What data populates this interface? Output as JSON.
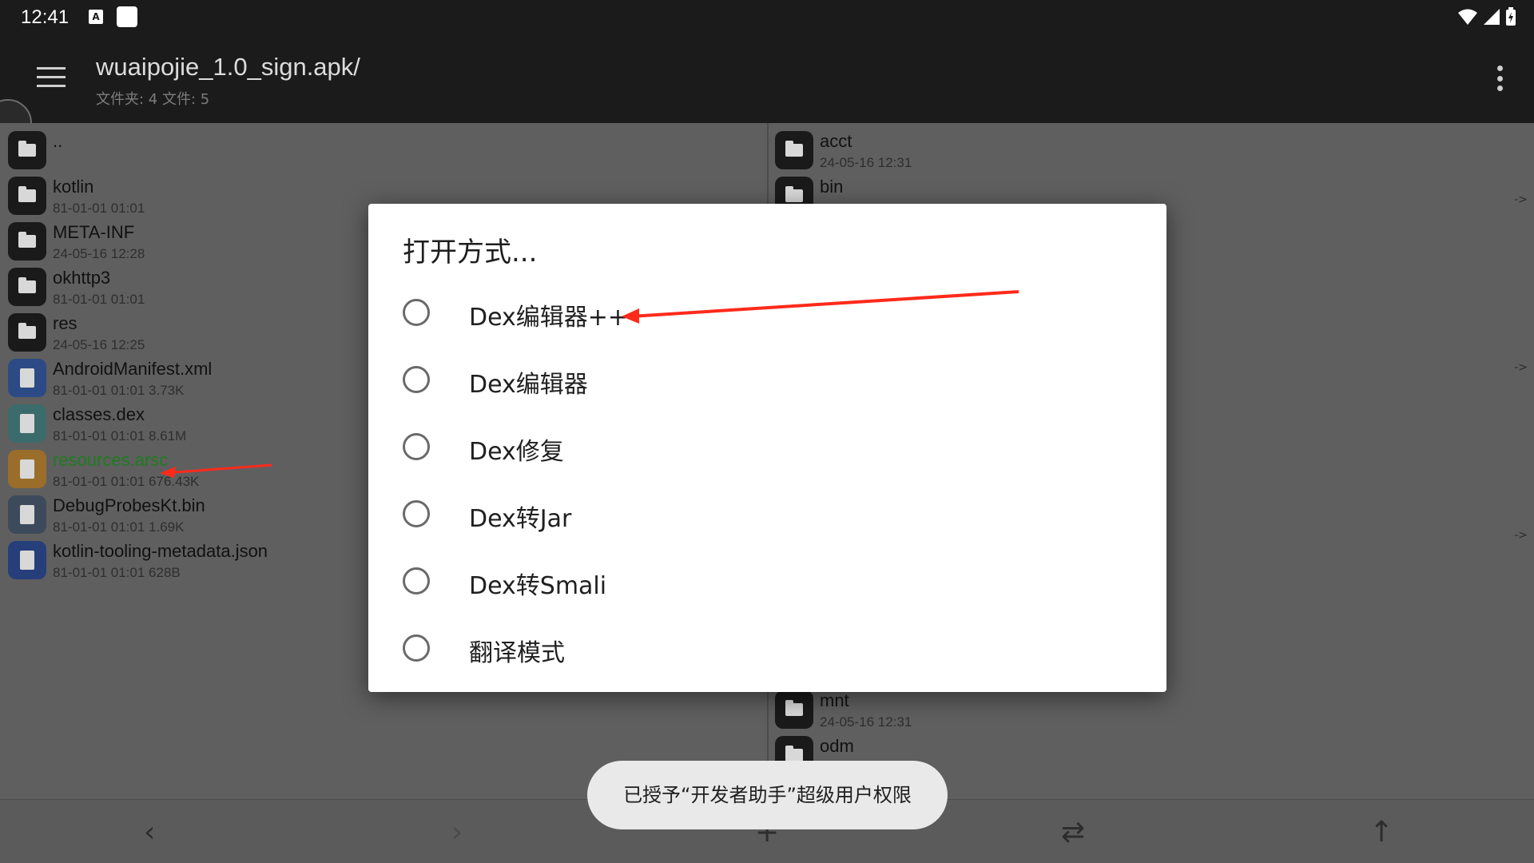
{
  "status_bar": {
    "time": "12:41",
    "a_icon": "A"
  },
  "toolbar": {
    "title": "wuaipojie_1.0_sign.apk/",
    "subtitle": "文件夹: 4  文件: 5"
  },
  "left_pane": {
    "items": [
      {
        "name": "..",
        "meta": "",
        "icon": "folder-icon"
      },
      {
        "name": "kotlin",
        "meta": "81-01-01 01:01",
        "icon": "folder-icon"
      },
      {
        "name": "META-INF",
        "meta": "24-05-16 12:28",
        "icon": "folder-icon"
      },
      {
        "name": "okhttp3",
        "meta": "81-01-01 01:01",
        "icon": "folder-icon"
      },
      {
        "name": "res",
        "meta": "24-05-16 12:25",
        "icon": "folder-icon"
      },
      {
        "name": "AndroidManifest.xml",
        "meta": "81-01-01 01:01  3.73K",
        "icon": "xml-file-icon"
      },
      {
        "name": "classes.dex",
        "meta": "81-01-01 01:01  8.61M",
        "icon": "dex-file-icon"
      },
      {
        "name": "resources.arsc",
        "meta": "81-01-01 01:01  676.43K",
        "icon": "arsc-file-icon"
      },
      {
        "name": "DebugProbesKt.bin",
        "meta": "81-01-01 01:01  1.69K",
        "icon": "bin-file-icon"
      },
      {
        "name": "kotlin-tooling-metadata.json",
        "meta": "81-01-01 01:01  628B",
        "icon": "json-file-icon"
      }
    ]
  },
  "right_pane": {
    "items": [
      {
        "name": "acct",
        "meta": "24-05-16 12:31"
      },
      {
        "name": "bin",
        "meta": ""
      },
      {
        "name": "mnt",
        "meta": "24-05-16 12:31"
      },
      {
        "name": "odm",
        "meta": ""
      }
    ],
    "link_marker": "->"
  },
  "dialog": {
    "title": "打开方式...",
    "options": [
      {
        "label": "Dex编辑器++"
      },
      {
        "label": "Dex编辑器"
      },
      {
        "label": "Dex修复"
      },
      {
        "label": "Dex转Jar"
      },
      {
        "label": "Dex转Smali"
      },
      {
        "label": "翻译模式"
      }
    ]
  },
  "toast": {
    "text": "已授予“开发者助手”超级用户权限"
  },
  "bottom_bar": {
    "back": "‹",
    "forward": "›",
    "add": "+",
    "swap": "⇄",
    "up": "↑"
  },
  "colors": {
    "toolbar_bg": "#1b1b1b",
    "pane_bg": "#5f5f5f",
    "dialog_bg": "#ffffff",
    "annotation_arrow": "#ff2a1a",
    "arsc_name": "#1f7b1f"
  }
}
